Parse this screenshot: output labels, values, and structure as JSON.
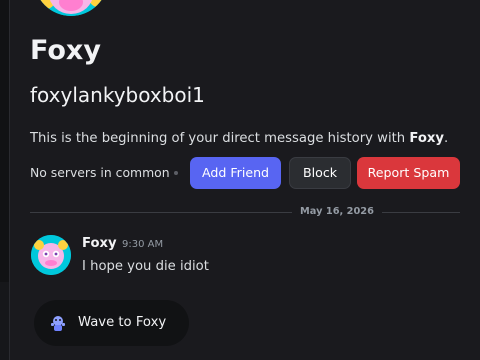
{
  "profile": {
    "display_name": "Foxy",
    "username": "foxylankyboxboi1",
    "intro_prefix": "This is the beginning of your direct message history with ",
    "intro_name": "Foxy",
    "intro_suffix": ".",
    "mutual_servers": "No servers in common"
  },
  "actions": {
    "add_friend": "Add Friend",
    "block": "Block",
    "report_spam": "Report Spam"
  },
  "divider": {
    "date": "May 16, 2026"
  },
  "message": {
    "author": "Foxy",
    "time": "9:30 AM",
    "text": "I hope you die idiot"
  },
  "wave": {
    "label": "Wave to Foxy"
  },
  "colors": {
    "background": "#1a1a1e",
    "add_friend": "#5865f2",
    "report_spam": "#da373c",
    "block": "#2b2d31"
  }
}
